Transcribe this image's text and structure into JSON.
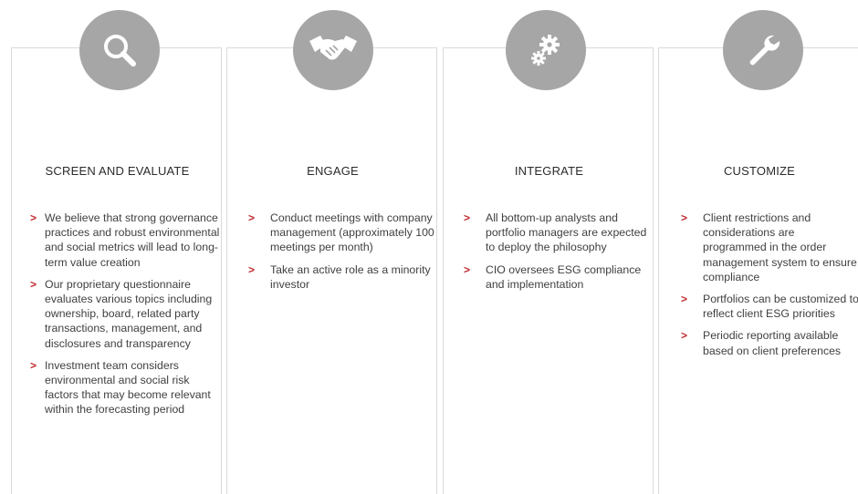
{
  "colors": {
    "accent": "#c0282d",
    "icon_bg": "#a6a6a6",
    "border": "#d9d9d9"
  },
  "columns": [
    {
      "title": "SCREEN AND EVALUATE",
      "icon": "magnifier-icon",
      "bullets": [
        "We believe that strong governance practices and robust environmental and social metrics will lead to long-term value creation",
        "Our proprietary questionnaire evaluates various topics including ownership, board, related party transactions, management, and disclosures and transparency",
        "Investment team considers environmental and social risk factors that may become relevant within the forecasting period"
      ]
    },
    {
      "title": "ENGAGE",
      "icon": "handshake-icon",
      "bullets": [
        "Conduct meetings with company management (approximately 100 meetings per month)",
        "Take an active role as a minority investor"
      ]
    },
    {
      "title": "INTEGRATE",
      "icon": "gears-icon",
      "bullets": [
        "All bottom-up analysts and portfolio managers are expected to deploy the philosophy",
        "CIO oversees ESG compliance and implementation"
      ]
    },
    {
      "title": "CUSTOMIZE",
      "icon": "wrench-icon",
      "bullets": [
        "Client restrictions and considerations are programmed in the order management system to ensure compliance",
        "Portfolios can be customized to reflect client ESG priorities",
        "Periodic reporting available based on client preferences"
      ]
    }
  ],
  "bullet_marker": ">"
}
